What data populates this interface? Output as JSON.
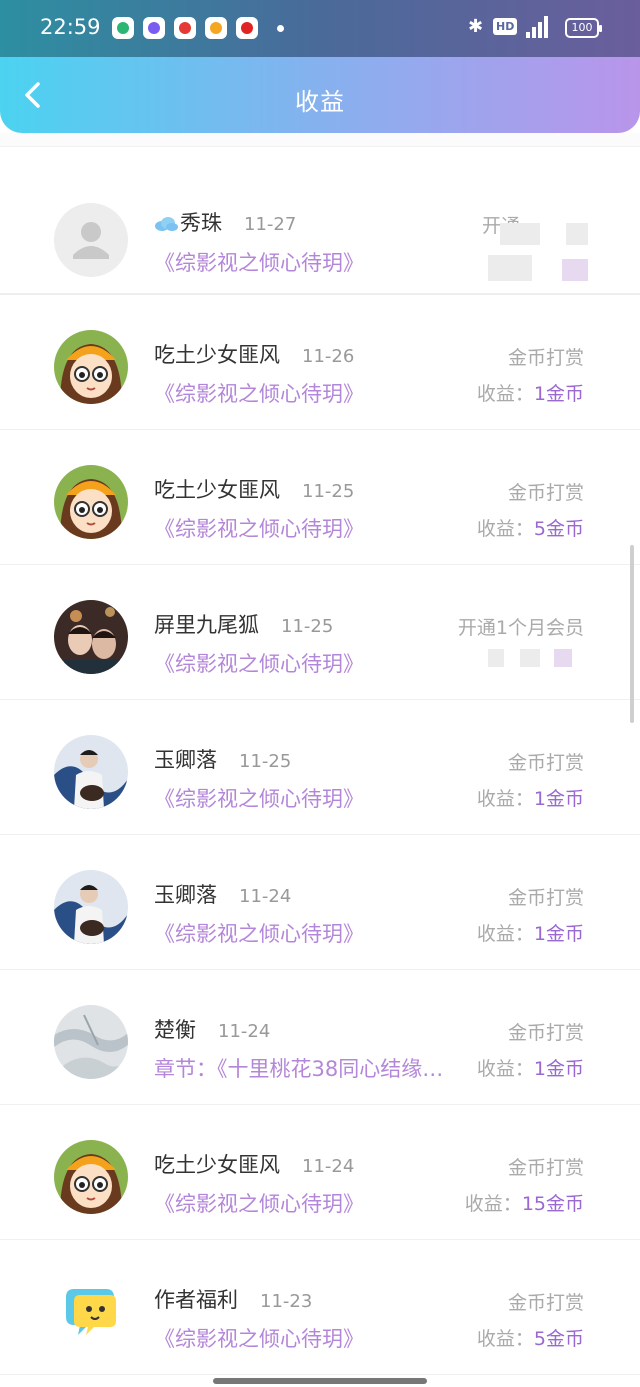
{
  "status": {
    "time": "22:59",
    "hd": "HD",
    "battery": "100"
  },
  "header": {
    "title": "收益"
  },
  "items": [
    {
      "name": "秀珠",
      "date": "11-27",
      "sub": "《综影视之倾心待玥》",
      "type": "开通",
      "earn_prefix": "",
      "amount": "",
      "avatar": "default"
    },
    {
      "name": "吃土少女匪风",
      "date": "11-26",
      "sub": "《综影视之倾心待玥》",
      "type": "金币打赏",
      "earn_prefix": "收益：",
      "amount": "1金币",
      "avatar": "girl"
    },
    {
      "name": "吃土少女匪风",
      "date": "11-25",
      "sub": "《综影视之倾心待玥》",
      "type": "金币打赏",
      "earn_prefix": "收益：",
      "amount": "5金币",
      "avatar": "girl"
    },
    {
      "name": "屏里九尾狐",
      "date": "11-25",
      "sub": "《综影视之倾心待玥》",
      "type": "开通1个月会员",
      "earn_prefix": "",
      "amount": "",
      "avatar": "couple"
    },
    {
      "name": "玉卿落",
      "date": "11-25",
      "sub": "《综影视之倾心待玥》",
      "type": "金币打赏",
      "earn_prefix": "收益：",
      "amount": "1金币",
      "avatar": "guitar"
    },
    {
      "name": "玉卿落",
      "date": "11-24",
      "sub": "《综影视之倾心待玥》",
      "type": "金币打赏",
      "earn_prefix": "收益：",
      "amount": "1金币",
      "avatar": "guitar"
    },
    {
      "name": "楚衡",
      "date": "11-24",
      "sub": "章节：《十里桃花38同心结缘…",
      "type": "金币打赏",
      "earn_prefix": "收益：",
      "amount": "1金币",
      "avatar": "ink"
    },
    {
      "name": "吃土少女匪风",
      "date": "11-24",
      "sub": "《综影视之倾心待玥》",
      "type": "金币打赏",
      "earn_prefix": "收益：",
      "amount": "15金币",
      "avatar": "girl"
    },
    {
      "name": "作者福利",
      "date": "11-23",
      "sub": "《综影视之倾心待玥》",
      "type": "金币打赏",
      "earn_prefix": "收益：",
      "amount": "5金币",
      "avatar": "bubble"
    }
  ],
  "colors": {
    "accent": "#9a68d0",
    "link": "#b486d9",
    "muted": "#aaaaaa"
  }
}
